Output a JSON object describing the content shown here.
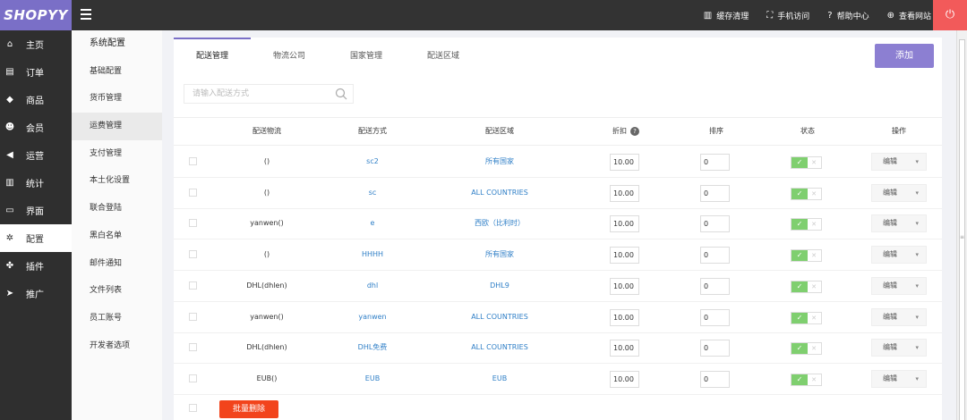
{
  "app": {
    "logo": "SHOPYY"
  },
  "topbar": {
    "links": [
      {
        "icon": "trash-icon",
        "glyph": "▥",
        "label": "缓存清理"
      },
      {
        "icon": "mobile-icon",
        "glyph": "⛶",
        "label": "手机访问"
      },
      {
        "icon": "help-icon",
        "glyph": "?",
        "label": "帮助中心"
      },
      {
        "icon": "globe-icon",
        "glyph": "⊕",
        "label": "查看网站"
      }
    ],
    "power_glyph": "⏻"
  },
  "nav": [
    {
      "label": "主页",
      "icon": "home-icon",
      "glyph": "⌂"
    },
    {
      "label": "订单",
      "icon": "order-icon",
      "glyph": "▤"
    },
    {
      "label": "商品",
      "icon": "cube-icon",
      "glyph": "◆"
    },
    {
      "label": "会员",
      "icon": "users-icon",
      "glyph": "☻"
    },
    {
      "label": "运营",
      "icon": "megaphone-icon",
      "glyph": "◀"
    },
    {
      "label": "统计",
      "icon": "chart-icon",
      "glyph": "▥"
    },
    {
      "label": "界面",
      "icon": "window-icon",
      "glyph": "▭"
    },
    {
      "label": "配置",
      "icon": "gear-icon",
      "glyph": "✲",
      "active": true
    },
    {
      "label": "插件",
      "icon": "puzzle-icon",
      "glyph": "✤"
    },
    {
      "label": "推广",
      "icon": "send-icon",
      "glyph": "➤"
    }
  ],
  "subnav": {
    "title": "系统配置",
    "items": [
      "基础配置",
      "货币管理",
      "运费管理",
      "支付管理",
      "本土化设置",
      "联合登陆",
      "黑白名单",
      "邮件通知",
      "文件列表",
      "员工账号",
      "开发者选项"
    ],
    "active_index": 2
  },
  "tabs": [
    "配送管理",
    "物流公司",
    "国家管理",
    "配送区域"
  ],
  "add_label": "添加",
  "search": {
    "placeholder": "请输入配送方式"
  },
  "columns": {
    "logistics": "配送物流",
    "method": "配送方式",
    "region": "配送区域",
    "discount": "折扣",
    "sort": "排序",
    "status": "状态",
    "action": "操作"
  },
  "rows": [
    {
      "logistics": "()",
      "method": "sc2",
      "region": "所有国家",
      "discount": "10.00",
      "sort": "0"
    },
    {
      "logistics": "()",
      "method": "sc",
      "region": "ALL COUNTRIES",
      "discount": "10.00",
      "sort": "0"
    },
    {
      "logistics": "yanwen()",
      "method": "e",
      "region": "西欧（比利时）",
      "discount": "10.00",
      "sort": "0"
    },
    {
      "logistics": "()",
      "method": "HHHH",
      "region": "所有国家",
      "discount": "10.00",
      "sort": "0"
    },
    {
      "logistics": "DHL(dhlen)",
      "method": "dhl",
      "region": "DHL9",
      "discount": "10.00",
      "sort": "0"
    },
    {
      "logistics": "yanwen()",
      "method": "yanwen",
      "region": "ALL COUNTRIES",
      "discount": "10.00",
      "sort": "0"
    },
    {
      "logistics": "DHL(dhlen)",
      "method": "DHL免费",
      "region": "ALL COUNTRIES",
      "discount": "10.00",
      "sort": "0"
    },
    {
      "logistics": "EUB()",
      "method": "EUB",
      "region": "EUB",
      "discount": "10.00",
      "sort": "0"
    }
  ],
  "edit_label": "编辑",
  "batch_delete_label": "批量删除",
  "colors": {
    "accent": "#7a6fc7",
    "add_button": "#8c7fd2",
    "danger": "#f2441c",
    "toggle_on": "#7fcf6f",
    "link": "#2f7fc7"
  }
}
